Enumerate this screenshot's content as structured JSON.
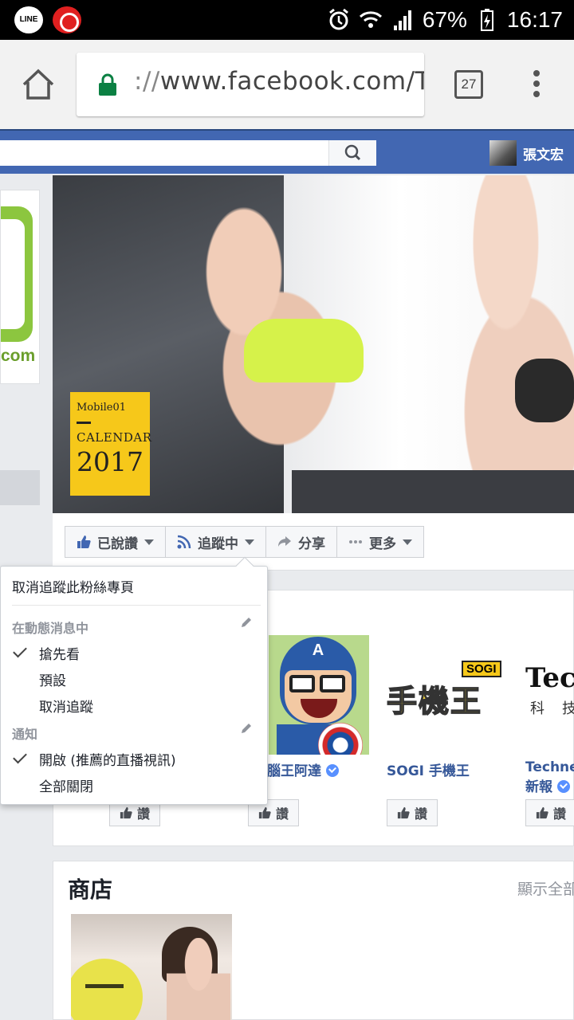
{
  "status_bar": {
    "line_label": "LINE",
    "battery": "67%",
    "time": "16:17"
  },
  "browser": {
    "url_prefix": "://",
    "url_main": "www.facebook.com/",
    "url_cut": "T",
    "tab_count": "27"
  },
  "fb_header": {
    "user_name": "張文宏"
  },
  "left": {
    "domain_fragment": "com"
  },
  "cover": {
    "brand": "Mobile01",
    "calendar_label": "CALENDAR",
    "year": "2017"
  },
  "actions": {
    "liked": "已說讚",
    "following": "追蹤中",
    "share": "分享",
    "more": "更多"
  },
  "dropdown": {
    "unfollow_page": "取消追蹤此粉絲專頁",
    "in_news_feed": "在動態消息中",
    "see_first": "搶先看",
    "default": "預設",
    "unfollow": "取消追蹤",
    "notifications": "通知",
    "on_live": "開啟 (推薦的直播視訊)",
    "all_off": "全部關閉"
  },
  "pages": {
    "items": [
      {
        "name": "腦王阿達",
        "like": "讚"
      },
      {
        "name": "SOGI 手機王",
        "like": "讚"
      },
      {
        "name_line1": "Technew",
        "name_line2": "新報",
        "like": "讚"
      }
    ],
    "first_like": "讚",
    "sogi_tag": "SOGI",
    "sogi_logo": "手機王",
    "technews_logo": "Tech",
    "technews_sub": "科技"
  },
  "shop": {
    "title": "商店",
    "see_all": "顯示全部"
  },
  "colors": {
    "fb_blue": "#4267b2",
    "link_blue": "#365899",
    "lock_green": "#0b8043"
  }
}
